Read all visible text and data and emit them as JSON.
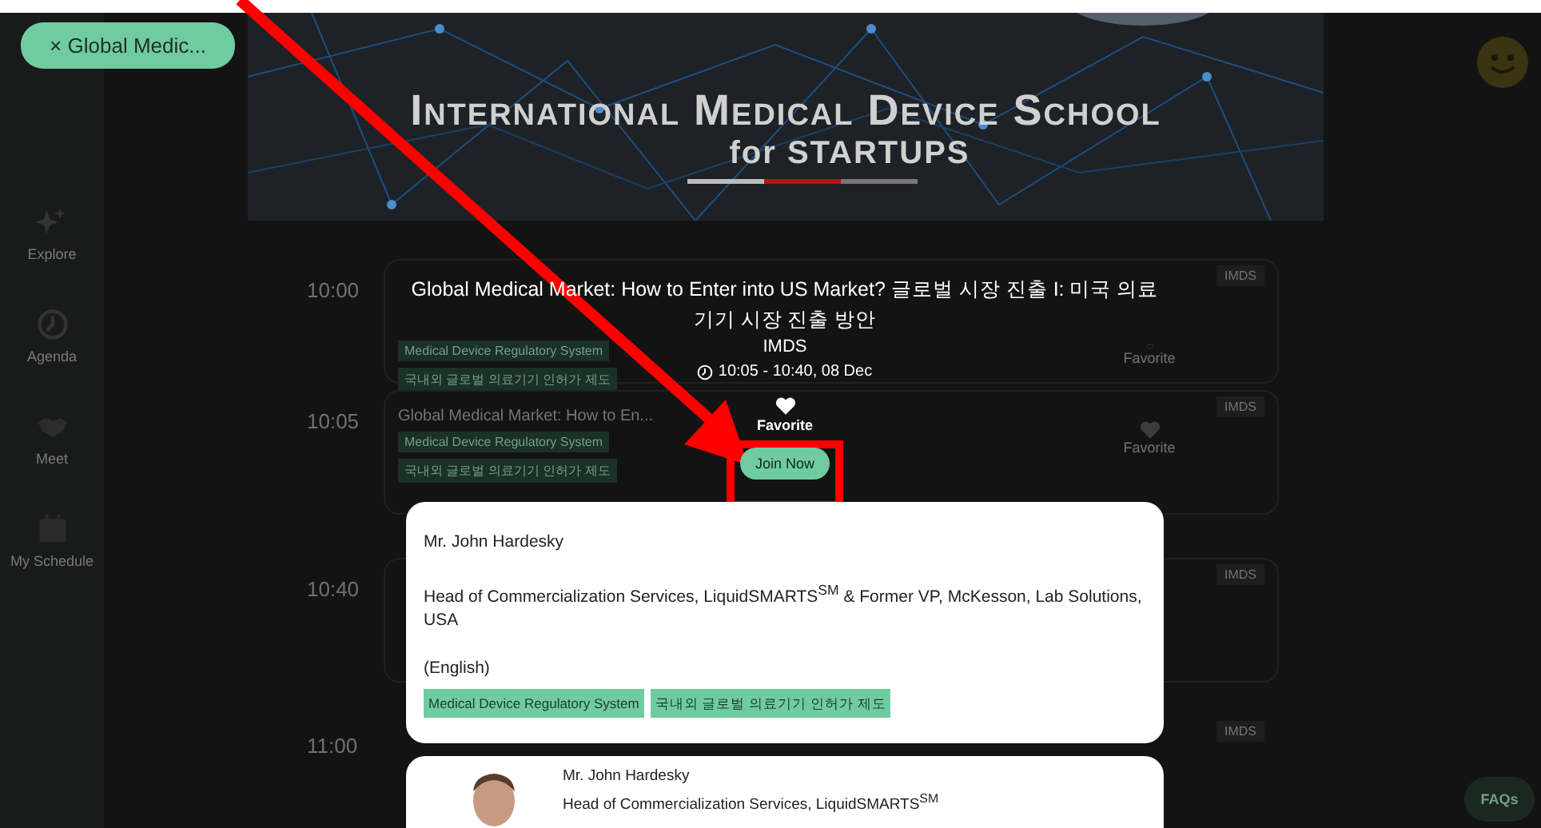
{
  "chip": {
    "icon": "×",
    "label": "Global Medic..."
  },
  "sidebar": {
    "items": [
      {
        "label": "Explore",
        "kind": "explore"
      },
      {
        "label": "Agenda",
        "kind": "agenda"
      },
      {
        "label": "Meet",
        "kind": "meet"
      },
      {
        "label": "My Schedule",
        "kind": "schedule"
      }
    ]
  },
  "banner": {
    "title": "International Medical Device School",
    "subtitle": "for STARTUPS"
  },
  "schedule": [
    {
      "time": "10:00",
      "tags": [
        "Medical Device Regulatory System",
        "국내외 글로벌 의료기기 인허가 제도"
      ],
      "badge": "IMDS",
      "favorite": "Favorite",
      "favorited": false
    },
    {
      "time": "10:05",
      "title": "Global Medical Market: How to En...",
      "tags": [
        "Medical Device Regulatory System",
        "국내외 글로벌 의료기기 인허가 제도"
      ],
      "badge": "IMDS",
      "favorite": "Favorite",
      "favorited": true
    },
    {
      "time": "10:40",
      "badge": "IMDS"
    },
    {
      "time": "11:00",
      "badge": "IMDS"
    }
  ],
  "modal": {
    "title": "Global Medical Market: How to Enter into US Market? 글로벌 시장 진출 I: 미국 의료 기기 시장 진출 방안",
    "track": "IMDS",
    "time": "10:05 - 10:40, 08 Dec",
    "favorite": "Favorite",
    "join": "Join Now",
    "speakers": [
      {
        "kind": "detail",
        "name": "Mr. John Hardesky",
        "role": "Head of Commercialization Services, LiquidSMARTS$^{SM}$ & Former VP, McKesson, Lab Solutions, USA",
        "language": "(English)",
        "tags": [
          "Medical Device Regulatory System",
          "국내외 글로벌 의료기기 인허가 제도"
        ]
      },
      {
        "kind": "profile",
        "name": "Mr. John Hardesky",
        "role": "Head of Commercialization Services, LiquidSMARTS$^{SM}$"
      }
    ]
  },
  "faq": "FAQs"
}
